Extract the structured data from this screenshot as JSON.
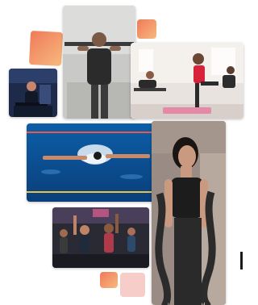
{
  "gallery": {
    "photos": [
      {
        "subject": "weightlifting-photo"
      },
      {
        "subject": "gym-training-photo"
      },
      {
        "subject": "group-exercise-photo"
      },
      {
        "subject": "swimming-photo"
      },
      {
        "subject": "fitness-class-photo"
      },
      {
        "subject": "battle-rope-photo"
      }
    ],
    "accent_colors": {
      "gradient_start": "#f07a5a",
      "gradient_end": "#f7b97d",
      "soft_pink": "#f6c4c0"
    }
  }
}
